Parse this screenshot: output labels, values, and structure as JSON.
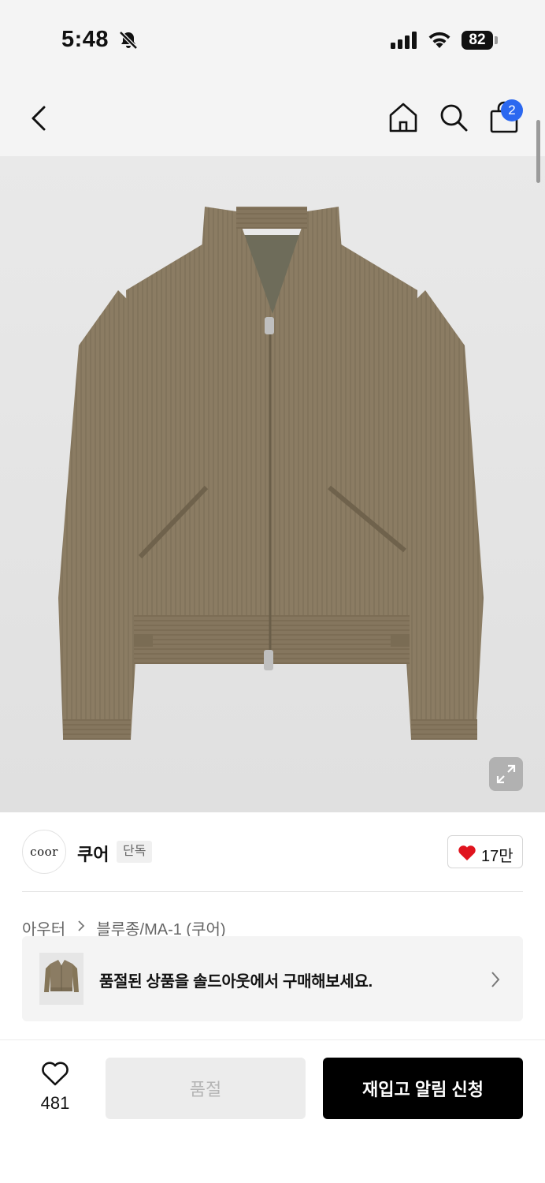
{
  "status_bar": {
    "time": "5:48",
    "battery": "82",
    "icons": [
      "bell-off-icon",
      "signal-icon",
      "wifi-icon",
      "battery-icon"
    ]
  },
  "nav": {
    "icons": [
      "back-icon",
      "home-icon",
      "search-icon",
      "shopping-bag-icon"
    ],
    "cart_count": "2",
    "badge_color": "#2b68f0"
  },
  "product": {
    "image": "corduroy-jacket-image",
    "image_colors": {
      "jacket": "#8b7c63",
      "background": "#e6e6e6"
    }
  },
  "brand": {
    "logo_text": "coor",
    "name": "쿠어",
    "badge": "단독",
    "like_count": "17만",
    "heart_color": "#e0141e"
  },
  "breadcrumb": {
    "category": "아우터",
    "subcategory": "블루종/MA-1 (쿠어)"
  },
  "soldout_banner": {
    "text": "품절된 상품을 솔드아웃에서 구매해보세요."
  },
  "bottom_bar": {
    "wish_count": "481",
    "soldout_label": "품절",
    "restock_label": "재입고 알림 신청"
  }
}
